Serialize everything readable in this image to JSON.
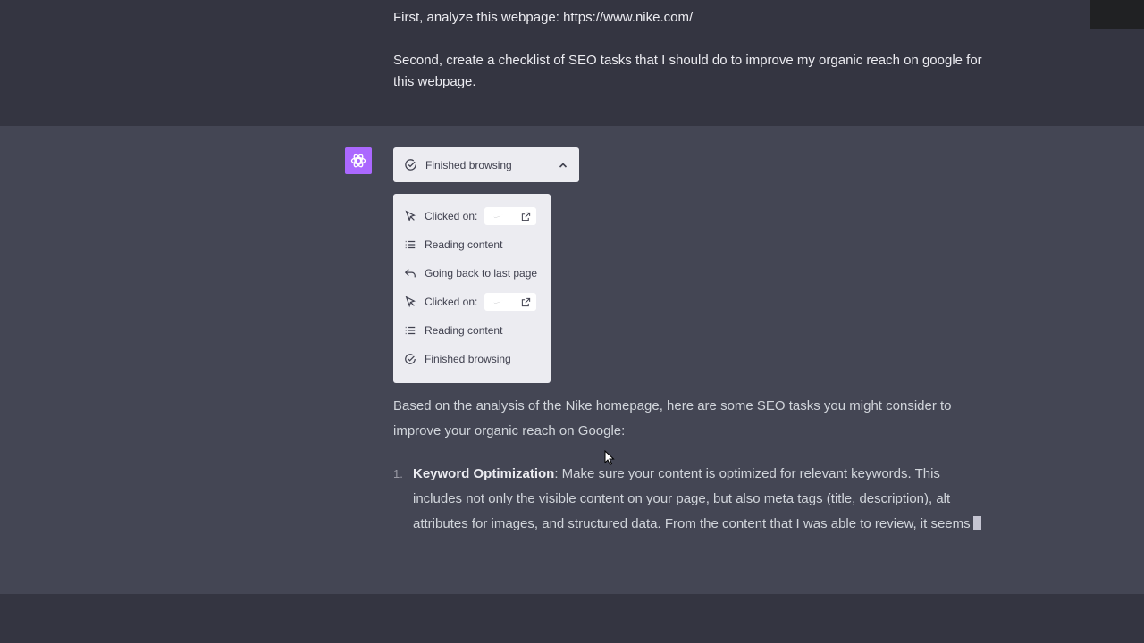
{
  "user_message": {
    "line1": "First, analyze this webpage: https://www.nike.com/",
    "line2": "Second, create a checklist of SEO tasks that I should do to improve my organic reach on google for this webpage."
  },
  "browsing": {
    "header_label": "Finished browsing",
    "steps": [
      {
        "icon": "cursor-icon",
        "label": "Clicked on:",
        "chip": true
      },
      {
        "icon": "list-icon",
        "label": "Reading content"
      },
      {
        "icon": "back-arrow-icon",
        "label": "Going back to last page"
      },
      {
        "icon": "cursor-icon",
        "label": "Clicked on:",
        "chip": true
      },
      {
        "icon": "list-icon",
        "label": "Reading content"
      },
      {
        "icon": "check-circle-icon",
        "label": "Finished browsing"
      }
    ]
  },
  "answer": {
    "intro": "Based on the analysis of the Nike homepage, here are some SEO tasks you might consider to improve your organic reach on Google:",
    "items": [
      {
        "number": "1.",
        "title": "Keyword Optimization",
        "text": ": Make sure your content is optimized for relevant keywords. This includes not only the visible content on your page, but also meta tags (title, description), alt attributes for images, and structured data. From the content that I was able to review, it seems"
      }
    ]
  },
  "colors": {
    "background": "#343541",
    "assistant_background": "#444654",
    "avatar": "#ab68ff",
    "panel": "#ececf1"
  }
}
